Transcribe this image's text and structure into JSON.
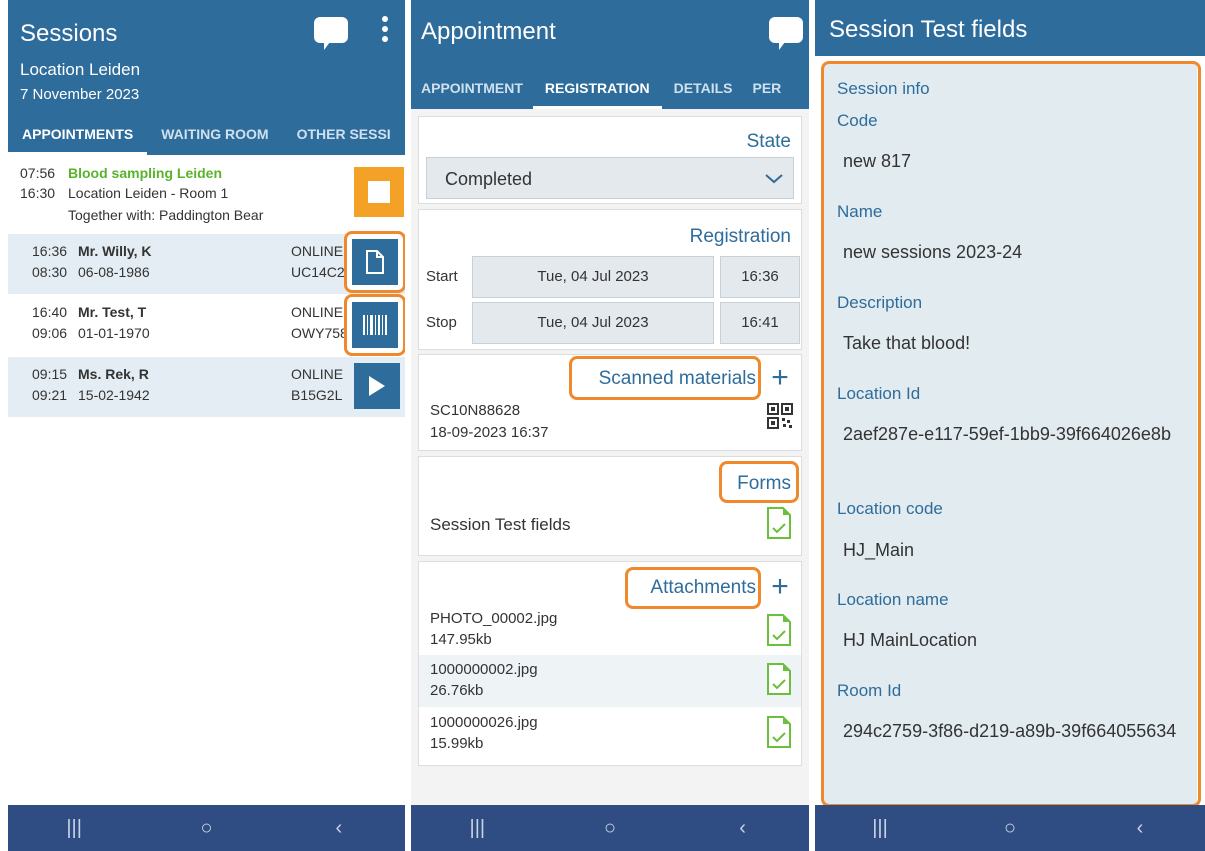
{
  "panel1": {
    "title": "Sessions",
    "location": "Location Leiden",
    "date": "7 November 2023",
    "tabs": [
      "APPOINTMENTS",
      "WAITING ROOM",
      "OTHER SESSI"
    ],
    "session": {
      "start_time": "07:56",
      "name": "Blood sampling Leiden",
      "end_time": "16:30",
      "room": "Location Leiden - Room 1",
      "together": "Together with: Paddington Bear"
    },
    "rows": [
      {
        "time": "16:36",
        "name": "Mr. Willy, K",
        "dob_time": "08:30",
        "dob": "06-08-1986",
        "status": "ONLINE",
        "code": "UC14C2"
      },
      {
        "time": "16:40",
        "name": "Mr. Test, T",
        "dob_time": "09:06",
        "dob": "01-01-1970",
        "status": "ONLINE",
        "code": "OWY758"
      },
      {
        "time": "09:15",
        "name": "Ms. Rek, R",
        "dob_time": "09:21",
        "dob": "15-02-1942",
        "status": "ONLINE",
        "code": "B15G2L"
      }
    ]
  },
  "panel2": {
    "title": "Appointment",
    "tabs": [
      "APPOINTMENT",
      "REGISTRATION",
      "DETAILS",
      "PER"
    ],
    "state_title": "State",
    "state_value": "Completed",
    "registration_title": "Registration",
    "start_label": "Start",
    "start_date": "Tue, 04 Jul 2023",
    "start_time": "16:36",
    "stop_label": "Stop",
    "stop_date": "Tue, 04 Jul 2023",
    "stop_time": "16:41",
    "scanned_title": "Scanned materials",
    "scanned_code": "SC10N88628",
    "scanned_time": "18-09-2023 16:37",
    "forms_title": "Forms",
    "form_name": "Session Test fields",
    "attachments_title": "Attachments",
    "attachments": [
      {
        "name": "PHOTO_00002.jpg",
        "size": "147.95kb"
      },
      {
        "name": "1000000002.jpg",
        "size": "26.76kb"
      },
      {
        "name": "1000000026.jpg",
        "size": "15.99kb"
      }
    ]
  },
  "panel3": {
    "title": "Session Test fields",
    "section": "Session info",
    "fields": [
      {
        "label": "Code",
        "value": "new 817"
      },
      {
        "label": "Name",
        "value": "new sessions 2023-24"
      },
      {
        "label": "Description",
        "value": "Take that blood!"
      },
      {
        "label": "Location Id",
        "value": "2aef287e-e117-59ef-1bb9-39f664026e8b"
      },
      {
        "label": "Location code",
        "value": "HJ_Main"
      },
      {
        "label": "Location name",
        "value": "HJ MainLocation"
      },
      {
        "label": "Room Id",
        "value": "294c2759-3f86-d219-a89b-39f664055634"
      }
    ]
  },
  "navbar": {
    "recent": "|||",
    "home": "○",
    "back": "‹"
  },
  "colors": {
    "primary": "#2e6c9b",
    "accent": "#f0892b",
    "navbar": "#2f4d83",
    "green": "#59b42c"
  }
}
